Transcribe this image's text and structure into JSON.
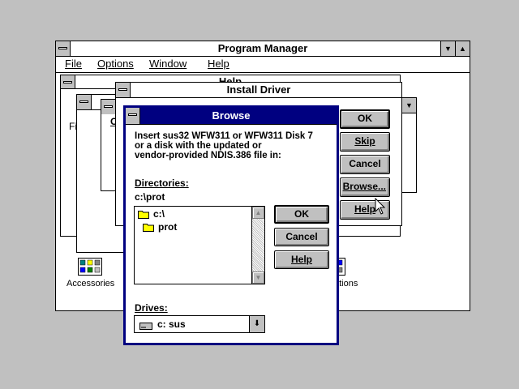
{
  "program_manager": {
    "title": "Program Manager",
    "menu": [
      "File",
      "Options",
      "Window",
      "Help"
    ],
    "icons": [
      "Accessories",
      "ations"
    ],
    "peek_text": [
      "Fi",
      "O",
      "Help"
    ]
  },
  "install_driver": {
    "title": "Install Driver",
    "buttons": {
      "ok": "OK",
      "skip": "Skip",
      "cancel": "Cancel",
      "browse": "Browse...",
      "help": "Help"
    }
  },
  "browse": {
    "title": "Browse",
    "message": "Insert sus32 WFW311 or WFW311 Disk 7 or a disk with the updated or vendor-provided NDIS.386 file in:",
    "message_lines": [
      "Insert sus32 WFW311 or WFW311 Disk 7",
      "or a disk with the updated or",
      "vendor-provided NDIS.386 file in:"
    ],
    "directories_label": "Directories:",
    "current_path": "c:\\prot",
    "directories": [
      "c:\\",
      "prot"
    ],
    "drives_label": "Drives:",
    "selected_drive": "c: sus",
    "buttons": {
      "ok": "OK",
      "cancel": "Cancel",
      "help": "Help"
    }
  }
}
